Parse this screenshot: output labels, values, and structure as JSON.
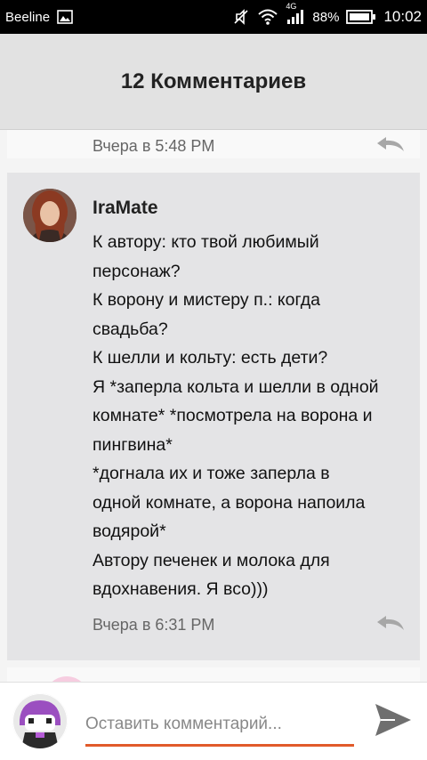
{
  "status_bar": {
    "carrier": "Beeline",
    "network": "4G",
    "battery": "88%",
    "time": "10:02",
    "icons": [
      "image-icon",
      "mute-icon",
      "wifi-icon",
      "signal-icon",
      "battery-icon"
    ]
  },
  "header": {
    "title": "12 Комментариев"
  },
  "comments": {
    "previous": {
      "time": "Вчера в 5:48 PM"
    },
    "main": {
      "author": "IraMate",
      "lines": [
        "К автору: кто твой любимый",
        "персонаж?",
        "К ворону и мистеру п.: когда",
        "свадьба?",
        "К шелли и кольту: есть дети?",
        "Я *заперла кольта и шелли в одной",
        "комнате* *посмотрела на ворона и",
        "пингвина*",
        "*догнала их и тоже заперла в",
        "одной комнате, а ворона напоила",
        "водярой*",
        "Автору печенек и молока для",
        "вдохнавения. Я всо)))"
      ],
      "time": "Вчера в 6:31 PM"
    }
  },
  "composer": {
    "placeholder": "Оставить комментарий...",
    "value": ""
  },
  "colors": {
    "accent": "#e15a2a",
    "header_bg": "#e2e2e2",
    "card_bg": "#e4e4e6"
  }
}
